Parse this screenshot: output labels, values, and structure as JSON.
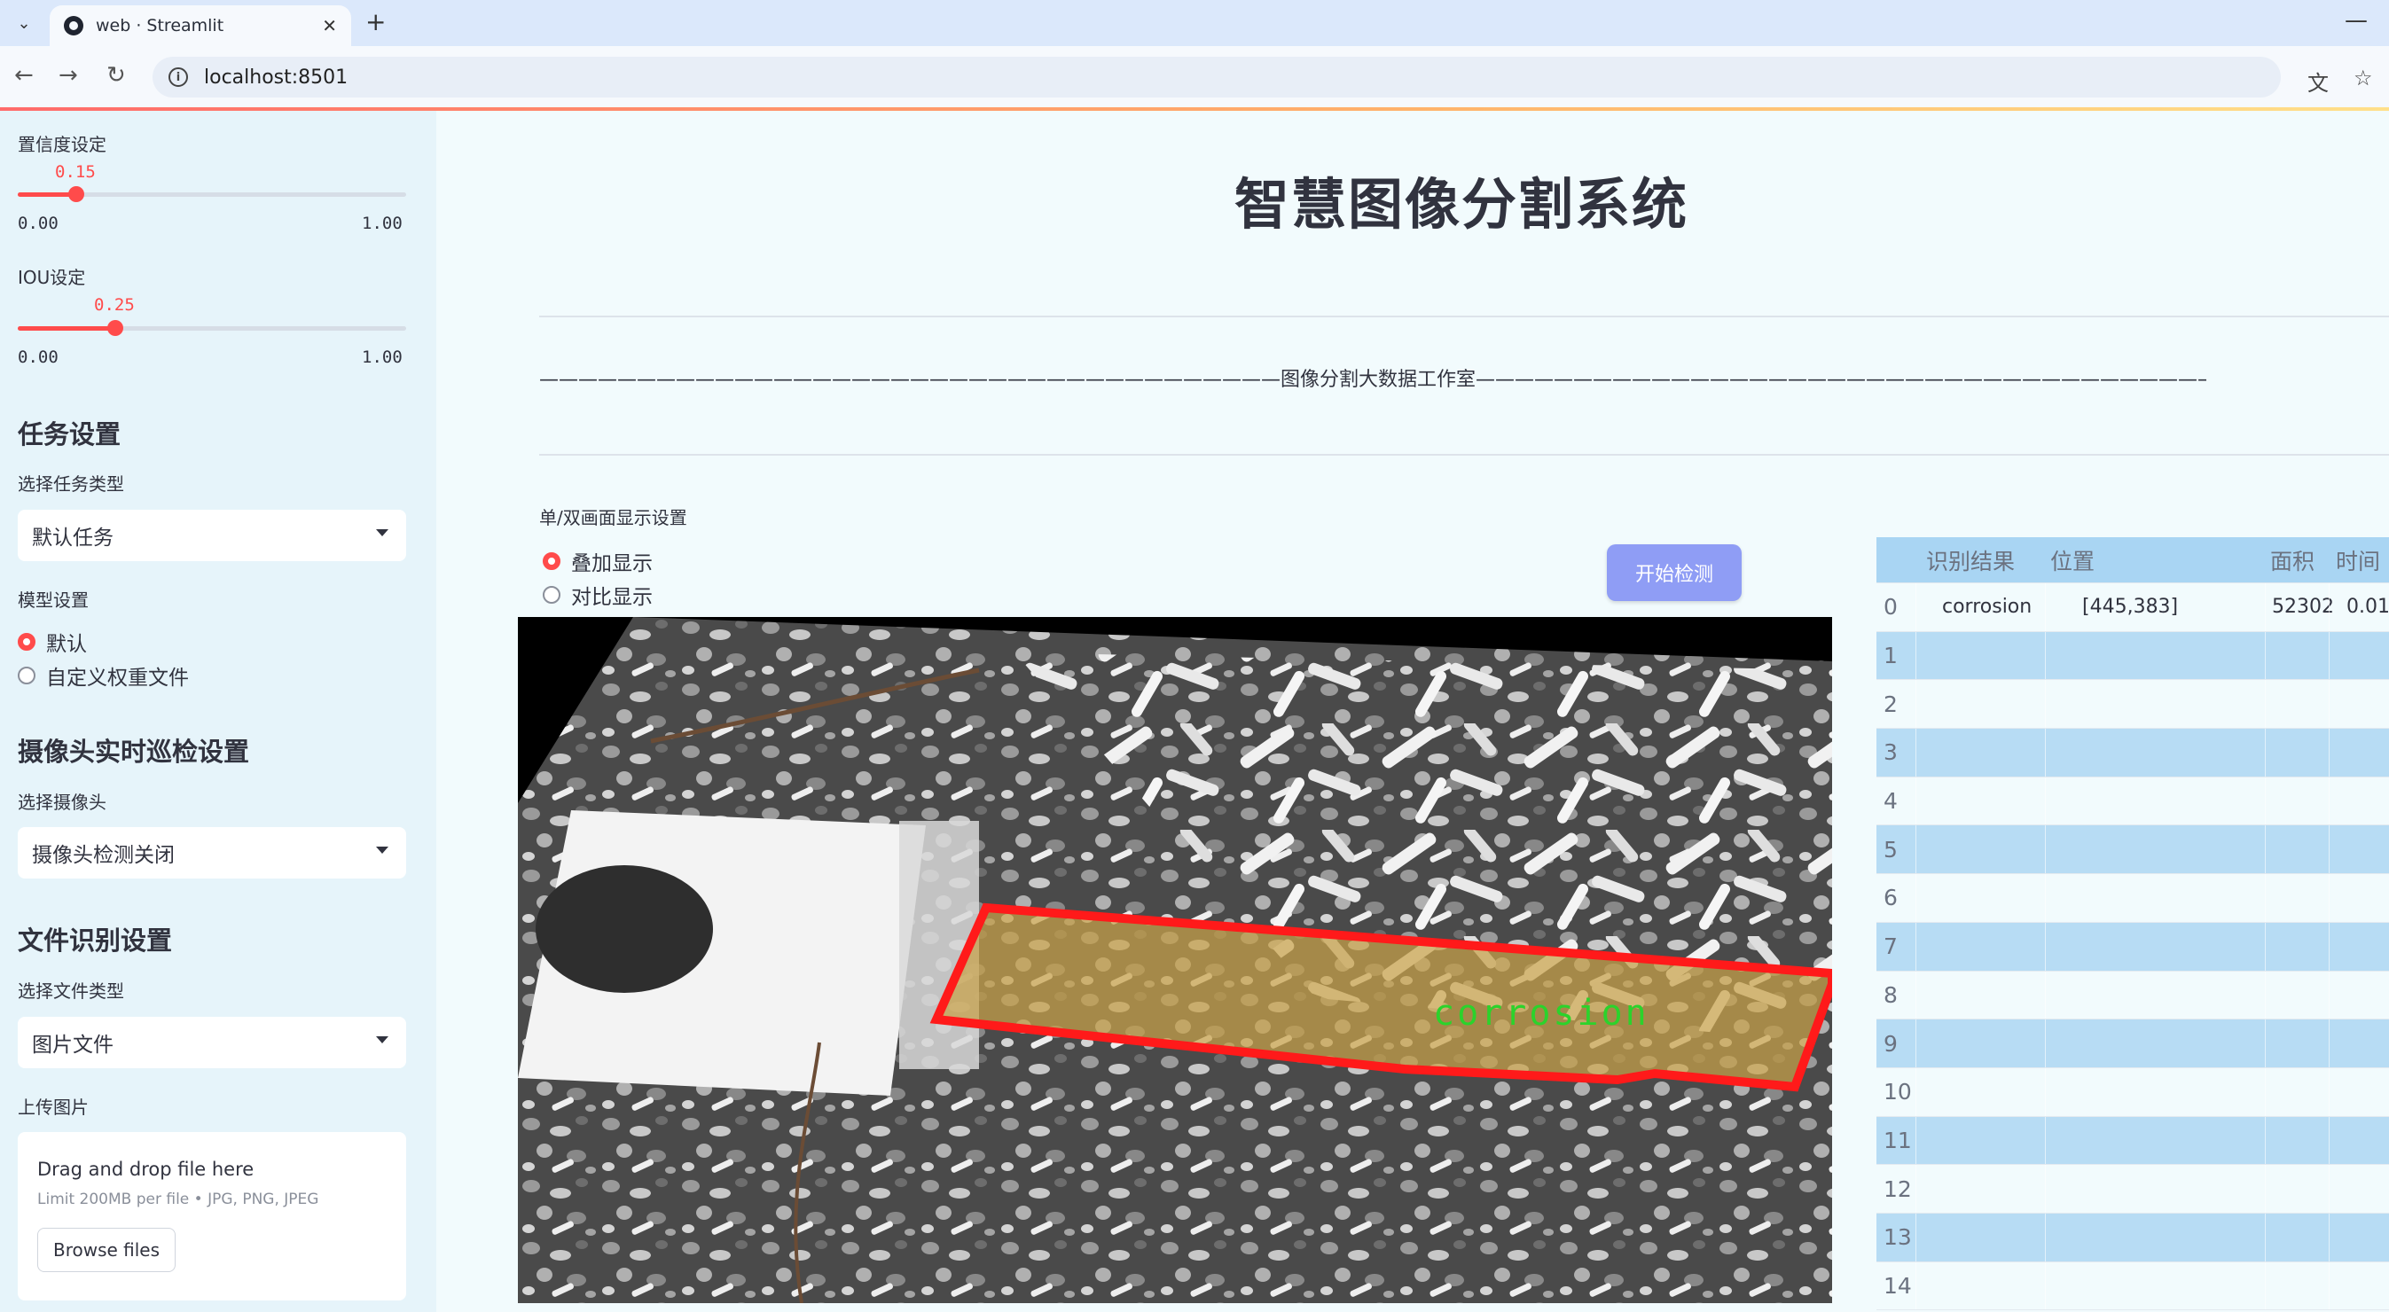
{
  "browser": {
    "tab_title": "web · Streamlit",
    "url": "localhost:8501"
  },
  "sidebar": {
    "confidence": {
      "label": "置信度设定",
      "value": "0.15",
      "fraction": 0.15,
      "min": "0.00",
      "max": "1.00"
    },
    "iou": {
      "label": "IOU设定",
      "value": "0.25",
      "fraction": 0.25,
      "min": "0.00",
      "max": "1.00"
    },
    "task_section": {
      "title": "任务设置",
      "select_label": "选择任务类型",
      "selected": "默认任务"
    },
    "model_section": {
      "label": "模型设置",
      "options": [
        "默认",
        "自定义权重文件"
      ],
      "selected_index": 0
    },
    "camera_section": {
      "title": "摄像头实时巡检设置",
      "select_label": "选择摄像头",
      "selected": "摄像头检测关闭"
    },
    "file_section": {
      "title": "文件识别设置",
      "select_label": "选择文件类型",
      "selected": "图片文件"
    },
    "upload": {
      "label": "上传图片",
      "title": "Drag and drop file here",
      "limit": "Limit 200MB per file • JPG, PNG, JPEG",
      "button": "Browse files"
    }
  },
  "main": {
    "title": "智慧图像分割系统",
    "divider_text": "——————————————————————————————————————图像分割大数据工作室——————————————————————————————————————",
    "display_mode": {
      "label": "单/双画面显示设置",
      "options": [
        "叠加显示",
        "对比显示"
      ],
      "selected_index": 0
    },
    "detect_button": "开始检测",
    "detection_label": "corrosion"
  },
  "results_table": {
    "columns": [
      "识别结果",
      "位置",
      "面积",
      "时间"
    ],
    "rows": [
      {
        "index": "0",
        "result": "corrosion",
        "position": "[445,383]",
        "area": "52302",
        "time": "0.01"
      },
      {
        "index": "1",
        "result": "",
        "position": "",
        "area": "",
        "time": ""
      },
      {
        "index": "2",
        "result": "",
        "position": "",
        "area": "",
        "time": ""
      },
      {
        "index": "3",
        "result": "",
        "position": "",
        "area": "",
        "time": ""
      },
      {
        "index": "4",
        "result": "",
        "position": "",
        "area": "",
        "time": ""
      },
      {
        "index": "5",
        "result": "",
        "position": "",
        "area": "",
        "time": ""
      },
      {
        "index": "6",
        "result": "",
        "position": "",
        "area": "",
        "time": ""
      },
      {
        "index": "7",
        "result": "",
        "position": "",
        "area": "",
        "time": ""
      },
      {
        "index": "8",
        "result": "",
        "position": "",
        "area": "",
        "time": ""
      },
      {
        "index": "9",
        "result": "",
        "position": "",
        "area": "",
        "time": ""
      },
      {
        "index": "10",
        "result": "",
        "position": "",
        "area": "",
        "time": ""
      },
      {
        "index": "11",
        "result": "",
        "position": "",
        "area": "",
        "time": ""
      },
      {
        "index": "12",
        "result": "",
        "position": "",
        "area": "",
        "time": ""
      },
      {
        "index": "13",
        "result": "",
        "position": "",
        "area": "",
        "time": ""
      },
      {
        "index": "14",
        "result": "",
        "position": "",
        "area": "",
        "time": ""
      }
    ]
  },
  "colors": {
    "accent": "#ff4b4b",
    "button": "#8f9df5",
    "mask_outline": "#ff1a1a",
    "mask_label": "#33dd33"
  }
}
